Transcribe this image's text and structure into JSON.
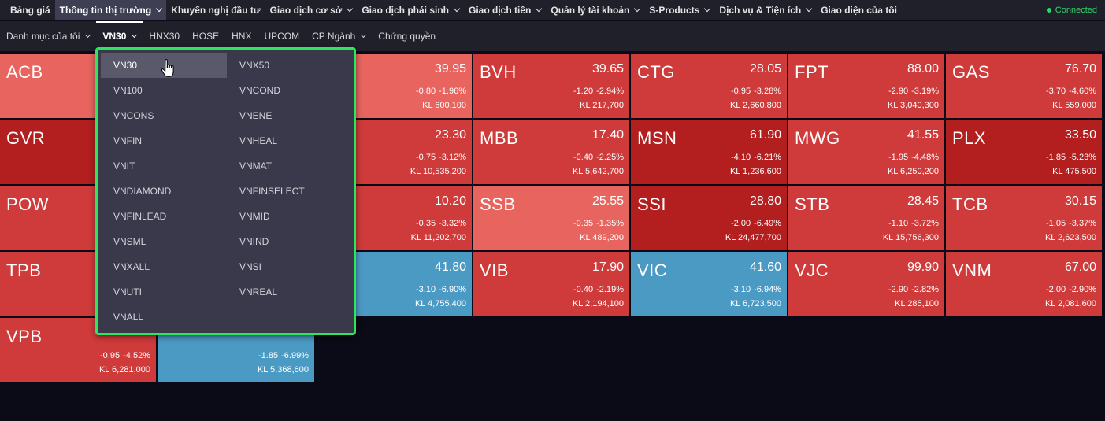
{
  "topnav": {
    "items": [
      {
        "label": "Bảng giá",
        "chevron": false
      },
      {
        "label": "Thông tin thị trường",
        "chevron": true
      },
      {
        "label": "Khuyến nghị đầu tư",
        "chevron": false
      },
      {
        "label": "Giao dịch cơ sở",
        "chevron": true
      },
      {
        "label": "Giao dịch phái sinh",
        "chevron": true
      },
      {
        "label": "Giao dịch tiền",
        "chevron": true
      },
      {
        "label": "Quản lý tài khoản",
        "chevron": true
      },
      {
        "label": "S-Products",
        "chevron": true
      },
      {
        "label": "Dịch vụ & Tiện ích",
        "chevron": true
      },
      {
        "label": "Giao diện của tôi",
        "chevron": false
      }
    ],
    "active_index": 1,
    "status": "Connected",
    "status_color": "#2fd36a"
  },
  "subnav": {
    "items": [
      {
        "label": "Danh mục của tôi",
        "chevron": true
      },
      {
        "label": "VN30",
        "chevron": true
      },
      {
        "label": "HNX30",
        "chevron": false
      },
      {
        "label": "HOSE",
        "chevron": false
      },
      {
        "label": "HNX",
        "chevron": false
      },
      {
        "label": "UPCOM",
        "chevron": false
      },
      {
        "label": "CP Ngành",
        "chevron": true
      },
      {
        "label": "Chứng quyền",
        "chevron": false
      }
    ],
    "active_index": 1
  },
  "colors": {
    "down_light": "#e8645f",
    "down": "#cf3a3a",
    "down_dark": "#b31e1e",
    "ceiling_floor": "#4b9ac4",
    "dropdown_border": "#2ee65b"
  },
  "tiles": [
    {
      "symbol": "ACB",
      "price": "",
      "change": "",
      "volume": "",
      "tone": "down_light"
    },
    {
      "symbol": "",
      "price": "",
      "change": "",
      "volume": "",
      "tone": "down_light"
    },
    {
      "symbol": "",
      "price": "39.95",
      "change": "-0.80  -1.96%",
      "volume": "KL 600,100",
      "tone": "down_light"
    },
    {
      "symbol": "BVH",
      "price": "39.65",
      "change": "-1.20  -2.94%",
      "volume": "KL 217,700",
      "tone": "down"
    },
    {
      "symbol": "CTG",
      "price": "28.05",
      "change": "-0.95  -3.28%",
      "volume": "KL 2,660,800",
      "tone": "down"
    },
    {
      "symbol": "FPT",
      "price": "88.00",
      "change": "-2.90  -3.19%",
      "volume": "KL 3,040,300",
      "tone": "down"
    },
    {
      "symbol": "GAS",
      "price": "76.70",
      "change": "-3.70  -4.60%",
      "volume": "KL 559,000",
      "tone": "down"
    },
    {
      "symbol": "GVR",
      "price": "",
      "change": "",
      "volume": "",
      "tone": "down_dark"
    },
    {
      "symbol": "",
      "price": "",
      "change": "",
      "volume": "",
      "tone": "down"
    },
    {
      "symbol": "",
      "price": "23.30",
      "change": "-0.75  -3.12%",
      "volume": "KL 10,535,200",
      "tone": "down"
    },
    {
      "symbol": "MBB",
      "price": "17.40",
      "change": "-0.40  -2.25%",
      "volume": "KL 5,642,700",
      "tone": "down"
    },
    {
      "symbol": "MSN",
      "price": "61.90",
      "change": "-4.10  -6.21%",
      "volume": "KL 1,236,600",
      "tone": "down_dark"
    },
    {
      "symbol": "MWG",
      "price": "41.55",
      "change": "-1.95  -4.48%",
      "volume": "KL 6,250,200",
      "tone": "down"
    },
    {
      "symbol": "PLX",
      "price": "33.50",
      "change": "-1.85  -5.23%",
      "volume": "KL 475,500",
      "tone": "down_dark"
    },
    {
      "symbol": "POW",
      "price": "",
      "change": "",
      "volume": "",
      "tone": "down"
    },
    {
      "symbol": "",
      "price": "",
      "change": "",
      "volume": "",
      "tone": "down"
    },
    {
      "symbol": "",
      "price": "10.20",
      "change": "-0.35  -3.32%",
      "volume": "KL 11,202,700",
      "tone": "down"
    },
    {
      "symbol": "SSB",
      "price": "25.55",
      "change": "-0.35  -1.35%",
      "volume": "KL 489,200",
      "tone": "down_light"
    },
    {
      "symbol": "SSI",
      "price": "28.80",
      "change": "-2.00  -6.49%",
      "volume": "KL 24,477,700",
      "tone": "down_dark"
    },
    {
      "symbol": "STB",
      "price": "28.45",
      "change": "-1.10  -3.72%",
      "volume": "KL 15,756,300",
      "tone": "down"
    },
    {
      "symbol": "TCB",
      "price": "30.15",
      "change": "-1.05  -3.37%",
      "volume": "KL 2,623,500",
      "tone": "down"
    },
    {
      "symbol": "TPB",
      "price": "",
      "change": "",
      "volume": "",
      "tone": "down"
    },
    {
      "symbol": "",
      "price": "",
      "change": "",
      "volume": "",
      "tone": "down"
    },
    {
      "symbol": "",
      "price": "41.80",
      "change": "-3.10  -6.90%",
      "volume": "KL 4,755,400",
      "tone": "ceiling_floor"
    },
    {
      "symbol": "VIB",
      "price": "17.90",
      "change": "-0.40  -2.19%",
      "volume": "KL 2,194,100",
      "tone": "down"
    },
    {
      "symbol": "VIC",
      "price": "41.60",
      "change": "-3.10  -6.94%",
      "volume": "KL 6,723,500",
      "tone": "ceiling_floor"
    },
    {
      "symbol": "VJC",
      "price": "99.90",
      "change": "-2.90  -2.82%",
      "volume": "KL 285,100",
      "tone": "down"
    },
    {
      "symbol": "VNM",
      "price": "67.00",
      "change": "-2.00  -2.90%",
      "volume": "KL 2,081,600",
      "tone": "down"
    },
    {
      "symbol": "VPB",
      "price": "",
      "change": "-0.95  -4.52%",
      "volume": "KL 6,281,000",
      "tone": "down"
    },
    {
      "symbol": "",
      "price": "",
      "change": "-1.85  -6.99%",
      "volume": "KL 5,368,600",
      "tone": "ceiling_floor"
    }
  ],
  "dropdown": {
    "selected": "VN30",
    "items": [
      "VN30",
      "VNX50",
      "VN100",
      "VNCOND",
      "VNCONS",
      "VNENE",
      "VNFIN",
      "VNHEAL",
      "VNIT",
      "VNMAT",
      "VNDIAMOND",
      "VNFINSELECT",
      "VNFINLEAD",
      "VNMID",
      "VNSML",
      "VNIND",
      "VNXALL",
      "VNSI",
      "VNUTI",
      "VNREAL",
      "VNALL"
    ]
  }
}
